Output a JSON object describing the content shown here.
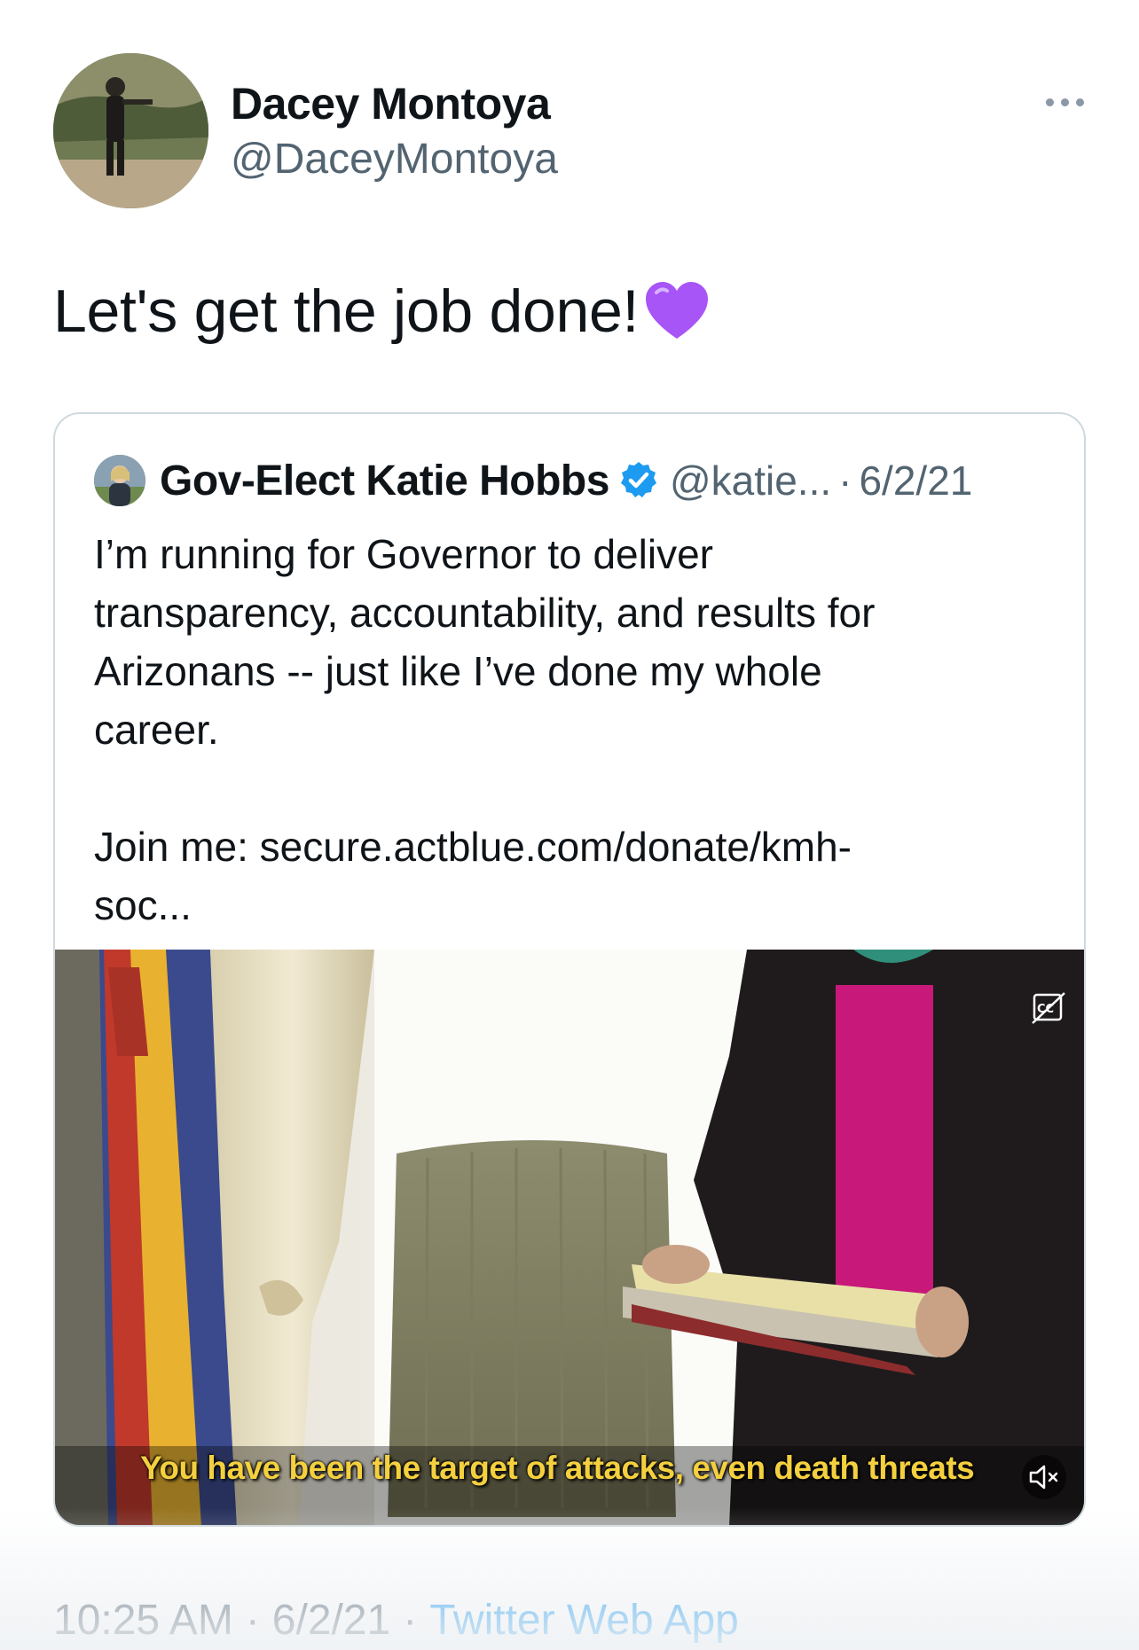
{
  "tweet": {
    "author_name": "Dacey Montoya",
    "author_handle": "@DaceyMontoya",
    "text": "Let's get the job done!",
    "emoji": "purple-heart"
  },
  "quote": {
    "author_name": "Gov-Elect Katie Hobbs",
    "author_handle": "@katie...",
    "separator": "·",
    "date": "6/2/21",
    "body_lines": [
      "I’m running for Governor to deliver",
      "transparency, accountability, and results for",
      "Arizonans -- just like I’ve done my whole",
      "career.",
      "Join me: secure.actblue.com/donate/kmh-",
      "soc..."
    ],
    "video": {
      "subtitle": "You have been the target of attacks, even death threats",
      "cc_icon": "closed-captions-off-icon",
      "mute_icon": "volume-muted-icon"
    }
  },
  "footer": {
    "time": "10:25 AM",
    "separator": "·",
    "date": "6/2/21",
    "app": "Twitter Web App"
  },
  "colors": {
    "text": "#0f1419",
    "secondary": "#536471",
    "link": "#1d9bf0",
    "border": "#cfd9de",
    "subtitle": "#f4d03f",
    "heart": "#a855f7"
  }
}
